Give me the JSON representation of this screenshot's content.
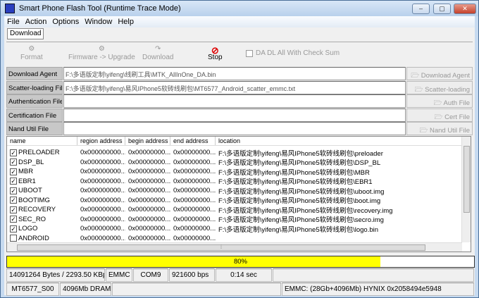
{
  "window": {
    "title": "Smart Phone Flash Tool (Runtime Trace Mode)",
    "controls": [
      "–",
      "▢",
      "✕"
    ]
  },
  "menu": [
    "File",
    "Action",
    "Options",
    "Window",
    "Help"
  ],
  "tabs": [
    {
      "label": "Download",
      "active": true
    }
  ],
  "toolbar": {
    "format": "Format",
    "firmware_upgrade": "Firmware -> Upgrade",
    "download": "Download",
    "stop": "Stop",
    "checksum_label": "DA DL All With Check Sum",
    "checksum_checked": false
  },
  "files": [
    {
      "label": "Download Agent",
      "value": "F:\\多语版定制\\yifeng\\线刷工具\\MTK_AllInOne_DA.bin",
      "button": "Download Agent"
    },
    {
      "label": "Scatter-loading File",
      "value": "F:\\多语版定制\\yifeng\\易风IPhone5软砖线刷包\\MT6577_Android_scatter_emmc.txt",
      "button": "Scatter-loading"
    },
    {
      "label": "Authentication File",
      "value": "",
      "button": "Auth File"
    },
    {
      "label": "Certification File",
      "value": "",
      "button": "Cert File"
    },
    {
      "label": "Nand Util File",
      "value": "",
      "button": "Nand Util File"
    }
  ],
  "list": {
    "columns": [
      "name",
      "region address",
      "begin address",
      "end address",
      "location"
    ],
    "rows": [
      {
        "checked": true,
        "name": "PRELOADER",
        "region": "0x000000000...",
        "begin": "0x00000000...",
        "end": "0x00000000...",
        "location": "F:\\多语版定制\\yifeng\\易风IPhone5软砖线刷包\\preloader"
      },
      {
        "checked": true,
        "name": "DSP_BL",
        "region": "0x000000000...",
        "begin": "0x00000000...",
        "end": "0x00000000...",
        "location": "F:\\多语版定制\\yifeng\\易风IPhone5软砖线刷包\\DSP_BL"
      },
      {
        "checked": true,
        "name": "MBR",
        "region": "0x000000000...",
        "begin": "0x00000000...",
        "end": "0x00000000...",
        "location": "F:\\多语版定制\\yifeng\\易风IPhone5软砖线刷包\\MBR"
      },
      {
        "checked": true,
        "name": "EBR1",
        "region": "0x000000000...",
        "begin": "0x00000000...",
        "end": "0x00000000...",
        "location": "F:\\多语版定制\\yifeng\\易风IPhone5软砖线刷包\\EBR1"
      },
      {
        "checked": true,
        "name": "UBOOT",
        "region": "0x000000000...",
        "begin": "0x00000000...",
        "end": "0x00000000...",
        "location": "F:\\多语版定制\\yifeng\\易风IPhone5软砖线刷包\\uboot.img"
      },
      {
        "checked": true,
        "name": "BOOTIMG",
        "region": "0x000000000...",
        "begin": "0x00000000...",
        "end": "0x00000000...",
        "location": "F:\\多语版定制\\yifeng\\易风IPhone5软砖线刷包\\boot.img"
      },
      {
        "checked": true,
        "name": "RECOVERY",
        "region": "0x000000000...",
        "begin": "0x00000000...",
        "end": "0x00000000...",
        "location": "F:\\多语版定制\\yifeng\\易风IPhone5软砖线刷包\\recovery.img"
      },
      {
        "checked": true,
        "name": "SEC_RO",
        "region": "0x000000000...",
        "begin": "0x00000000...",
        "end": "0x00000000...",
        "location": "F:\\多语版定制\\yifeng\\易风IPhone5软砖线刷包\\secro.img"
      },
      {
        "checked": true,
        "name": "LOGO",
        "region": "0x000000000...",
        "begin": "0x00000000...",
        "end": "0x00000000...",
        "location": "F:\\多语版定制\\yifeng\\易风IPhone5软砖线刷包\\logo.bin"
      },
      {
        "checked": false,
        "name": "ANDROID",
        "region": "0x000000000...",
        "begin": "0x00000000...",
        "end": "0x00000000...",
        "location": ""
      }
    ]
  },
  "progress": {
    "percent": 80,
    "label": "80%",
    "color": "#ffff00"
  },
  "status1": [
    "14091264 Bytes / 2293.50 KBps",
    "EMMC",
    "COM9",
    "921600 bps",
    "0:14 sec",
    ""
  ],
  "status2": [
    "MT6577_S00",
    "4096Mb DRAM",
    "",
    "EMMC: (28Gb+4096Mb) HYNIX 0x2058494e5948"
  ]
}
